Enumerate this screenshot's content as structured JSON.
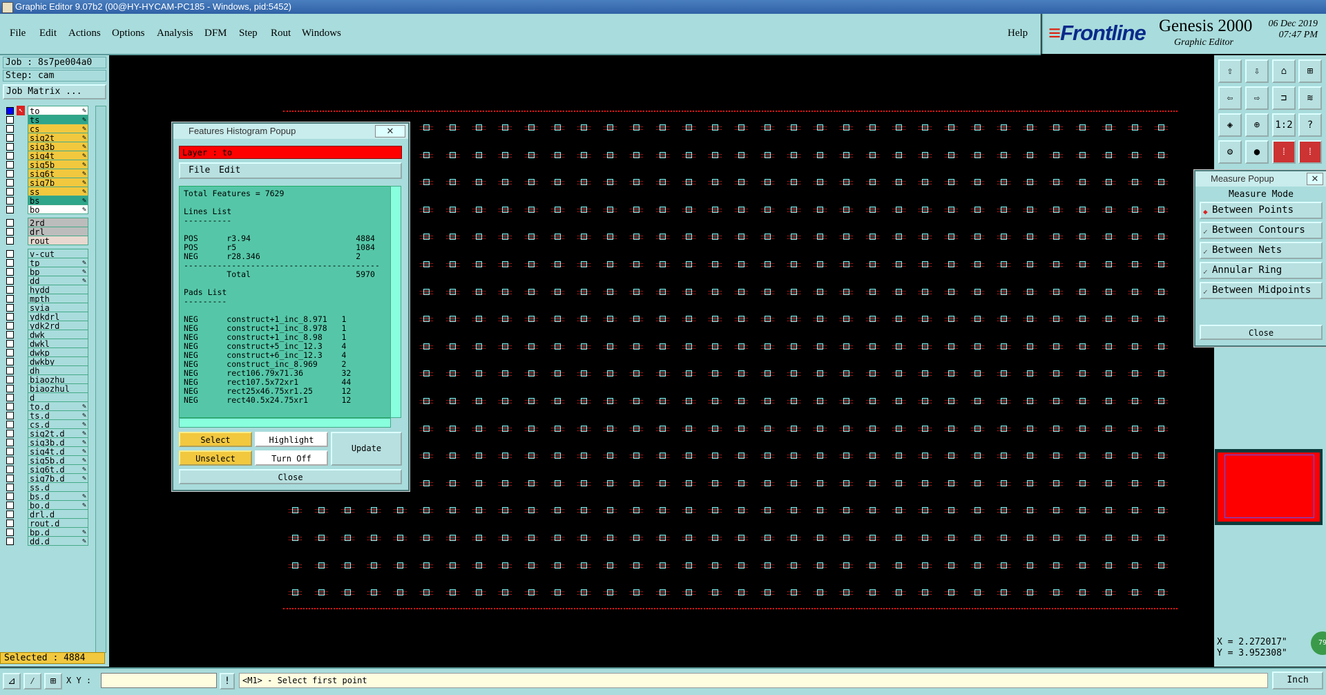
{
  "window": {
    "title": "Graphic Editor 9.07b2 (00@HY-HYCAM-PC185 - Windows, pid:5452)"
  },
  "menu": {
    "items": [
      "File",
      "Edit",
      "Actions",
      "Options",
      "Analysis",
      "DFM",
      "Step",
      "Rout",
      "Windows"
    ],
    "help": "Help"
  },
  "brand": {
    "logo_prefix": "F",
    "logo_rest": "rontline",
    "product": "Genesis 2000",
    "subtitle": "Graphic Editor",
    "date": "06  Dec  2019",
    "time": "07:47  PM"
  },
  "left_panel": {
    "job": "Job : 8s7pe004a0",
    "step": "Step: cam",
    "job_matrix_button": "Job Matrix ...",
    "layers": [
      {
        "name": "to",
        "color": "#ffffff",
        "editable": true
      },
      {
        "name": "ts",
        "color": "#2fa58a",
        "editable": true
      },
      {
        "name": "cs",
        "color": "#f2c83f",
        "editable": true
      },
      {
        "name": "sig2t",
        "color": "#f2c83f",
        "editable": true
      },
      {
        "name": "sig3b",
        "color": "#f2c83f",
        "editable": true
      },
      {
        "name": "sig4t",
        "color": "#f2c83f",
        "editable": true
      },
      {
        "name": "sig5b",
        "color": "#f2c83f",
        "editable": true
      },
      {
        "name": "sig6t",
        "color": "#f2c83f",
        "editable": true
      },
      {
        "name": "sig7b",
        "color": "#f2c83f",
        "editable": true
      },
      {
        "name": "ss",
        "color": "#f2c83f",
        "editable": true
      },
      {
        "name": "bs",
        "color": "#2fa58a",
        "editable": true
      },
      {
        "name": "bo",
        "color": "#ffffff",
        "editable": true
      },
      {
        "name": "2rd",
        "color": "#bcbcbc",
        "editable": false
      },
      {
        "name": "drl",
        "color": "#bcbcbc",
        "editable": false
      },
      {
        "name": "rout",
        "color": "#e8d8d0",
        "editable": false
      },
      {
        "name": "v-cut",
        "color": "#a9dcdc",
        "editable": false
      },
      {
        "name": "tp",
        "color": "#a9dcdc",
        "editable": true
      },
      {
        "name": "bp",
        "color": "#a9dcdc",
        "editable": true
      },
      {
        "name": "dd",
        "color": "#a9dcdc",
        "editable": true
      },
      {
        "name": "hydd",
        "color": "#a9dcdc",
        "editable": false
      },
      {
        "name": "mpth",
        "color": "#a9dcdc",
        "editable": false
      },
      {
        "name": "svia",
        "color": "#a9dcdc",
        "editable": false
      },
      {
        "name": "ydkdrl",
        "color": "#a9dcdc",
        "editable": false
      },
      {
        "name": "ydk2rd",
        "color": "#a9dcdc",
        "editable": false
      },
      {
        "name": "dwk",
        "color": "#a9dcdc",
        "editable": false
      },
      {
        "name": "dwkl",
        "color": "#a9dcdc",
        "editable": false
      },
      {
        "name": "dwkp",
        "color": "#a9dcdc",
        "editable": false
      },
      {
        "name": "dwkby",
        "color": "#a9dcdc",
        "editable": false
      },
      {
        "name": "dh",
        "color": "#a9dcdc",
        "editable": false
      },
      {
        "name": "biaozhu",
        "color": "#a9dcdc",
        "editable": false
      },
      {
        "name": "biaozhul",
        "color": "#a9dcdc",
        "editable": false
      },
      {
        "name": "d",
        "color": "#a9dcdc",
        "editable": false
      },
      {
        "name": "to.d",
        "color": "#a9dcdc",
        "editable": true
      },
      {
        "name": "ts.d",
        "color": "#a9dcdc",
        "editable": true
      },
      {
        "name": "cs.d",
        "color": "#a9dcdc",
        "editable": true
      },
      {
        "name": "sig2t.d",
        "color": "#a9dcdc",
        "editable": true
      },
      {
        "name": "sig3b.d",
        "color": "#a9dcdc",
        "editable": true
      },
      {
        "name": "sig4t.d",
        "color": "#a9dcdc",
        "editable": true
      },
      {
        "name": "sig5b.d",
        "color": "#a9dcdc",
        "editable": true
      },
      {
        "name": "sig6t.d",
        "color": "#a9dcdc",
        "editable": true
      },
      {
        "name": "sig7b.d",
        "color": "#a9dcdc",
        "editable": true
      },
      {
        "name": "ss.d",
        "color": "#a9dcdc",
        "editable": false
      },
      {
        "name": "bs.d",
        "color": "#a9dcdc",
        "editable": true
      },
      {
        "name": "bo.d",
        "color": "#a9dcdc",
        "editable": true
      },
      {
        "name": "drl.d",
        "color": "#a9dcdc",
        "editable": false
      },
      {
        "name": "rout.d",
        "color": "#a9dcdc",
        "editable": false
      },
      {
        "name": "bp.d",
        "color": "#a9dcdc",
        "editable": true
      },
      {
        "name": "dd.d",
        "color": "#a9dcdc",
        "editable": true
      }
    ],
    "selected": "Selected : 4884"
  },
  "histogram_popup": {
    "title": "Features Histogram Popup",
    "close_x": "✕",
    "layer_label": "Layer :  to",
    "menu": [
      "File",
      "Edit"
    ],
    "text_lines": [
      "Total Features = 7629",
      "",
      "Lines List",
      "----------",
      "",
      "POS      r3.94                      4884",
      "POS      r5                         1084",
      "NEG      r28.346                    2",
      "-----------------------------------------",
      "         Total                      5970",
      "",
      "Pads List",
      "---------",
      "",
      "NEG      construct+1_inc_8.971   1",
      "NEG      construct+1_inc_8.978   1",
      "NEG      construct+1_inc_8.98    1",
      "NEG      construct+5_inc_12.3    4",
      "NEG      construct+6_inc_12.3    4",
      "NEG      construct_inc_8.969     2",
      "NEG      rect106.79x71.36        32",
      "NEG      rect107.5x72xr1         44",
      "NEG      rect25x46.75xr1.25      12",
      "NEG      rect40.5x24.75xr1       12"
    ],
    "buttons": {
      "select": "Select",
      "highlight": "Highlight",
      "unselect": "Unselect",
      "turn_off": "Turn Off",
      "update": "Update",
      "close": "Close"
    }
  },
  "measure_popup": {
    "title": "Measure Popup",
    "mode_label": "Measure Mode",
    "modes": [
      "Between Points",
      "Between Contours",
      "Between Nets",
      "Annular Ring",
      "Between Midpoints"
    ],
    "active_mode": "Between Points",
    "close": "Close"
  },
  "coords": {
    "x": "X = 2.272017\"",
    "y": "Y = 3.952308\""
  },
  "zoom_badge": "79",
  "status": {
    "xy_label": "X Y :",
    "message": "<M1> - Select first point",
    "unit": "Inch"
  },
  "colors": {
    "panel": "#a9dcdc",
    "selected_bg": "#f2c83f",
    "layer_red": "#ff0000",
    "canvas": "#000000"
  }
}
